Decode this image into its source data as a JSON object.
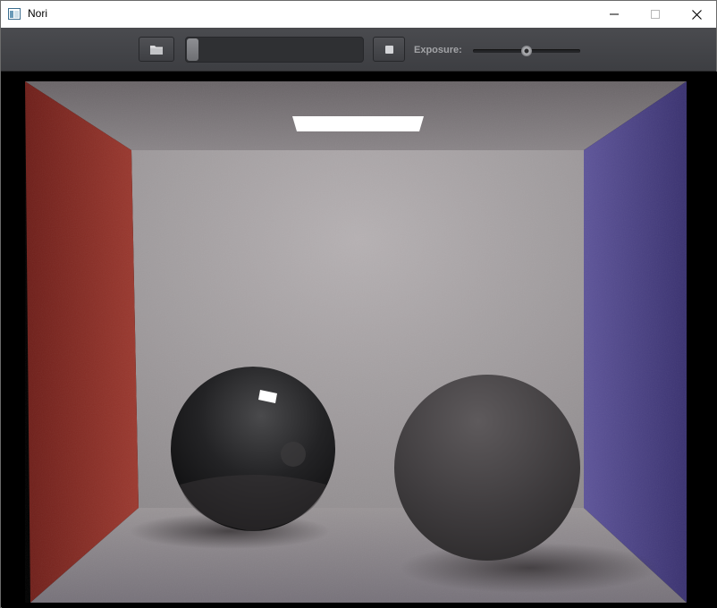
{
  "window": {
    "title": "Nori",
    "icons": {
      "app": "app-window-icon",
      "minimize": "minimize-icon",
      "maximize": "maximize-icon",
      "close": "close-icon"
    }
  },
  "toolbar": {
    "open_icon": "folder-open-icon",
    "stop_icon": "stop-icon",
    "progress": 0.06,
    "exposure_label": "Exposure:",
    "exposure_value": 0.5
  },
  "scene": {
    "description_icon": "render-image",
    "colors": {
      "left_wall": "#8a2a24",
      "right_wall": "#4a3f86",
      "back_wall": "#a39ea0",
      "light": "#ffffff"
    }
  }
}
